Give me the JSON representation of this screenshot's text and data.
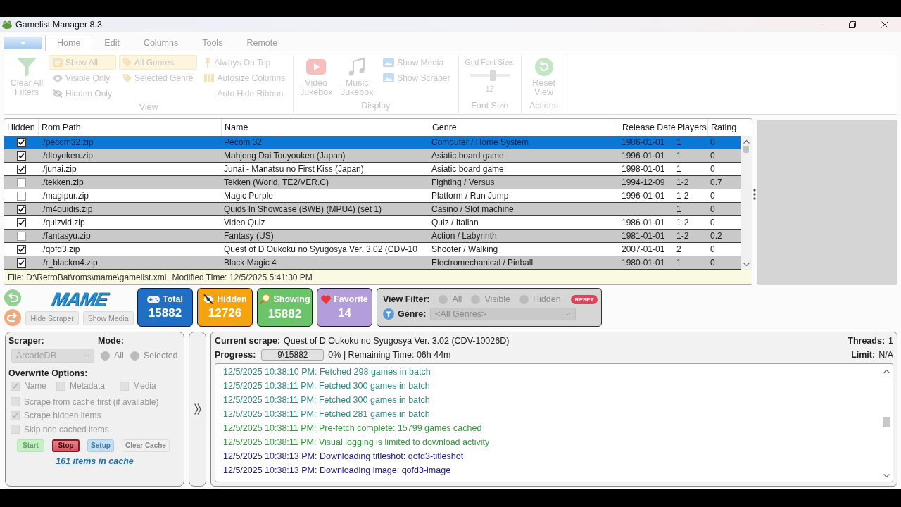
{
  "window": {
    "title": "Gamelist Manager 8.3"
  },
  "ribbon": {
    "disabled": true,
    "tabs": [
      {
        "label": "Home",
        "selected": true
      },
      {
        "label": "Edit",
        "selected": false
      },
      {
        "label": "Columns",
        "selected": false
      },
      {
        "label": "Tools",
        "selected": false
      },
      {
        "label": "Remote",
        "selected": false
      }
    ],
    "groups": [
      {
        "label": "View",
        "columns": [
          [
            {
              "kind": "large",
              "label": "Clear All Filters"
            }
          ],
          [
            {
              "kind": "toggle",
              "label": "Show All",
              "selected": true
            },
            {
              "kind": "toggle",
              "label": "Visible Only",
              "selected": false
            },
            {
              "kind": "toggle",
              "label": "Hidden Only",
              "selected": false
            }
          ],
          [
            {
              "kind": "toggle",
              "label": "All Genres",
              "selected": true
            },
            {
              "kind": "toggle",
              "label": "Selected Genre",
              "selected": false
            }
          ],
          [
            {
              "kind": "small",
              "label": "Always On Top"
            },
            {
              "kind": "small",
              "label": "Autosize Columns"
            },
            {
              "kind": "small",
              "label": "Auto Hide Ribbon"
            }
          ]
        ]
      },
      {
        "label": "Display",
        "columns": [
          [
            {
              "kind": "large",
              "label": "Video Jukebox"
            }
          ],
          [
            {
              "kind": "large",
              "label": "Music Jukebox"
            }
          ],
          [
            {
              "kind": "small",
              "label": "Show Media"
            },
            {
              "kind": "small",
              "label": "Show Scraper"
            }
          ]
        ]
      },
      {
        "label": "Font Size",
        "columns": [
          [
            {
              "kind": "slider",
              "label": "Grid Font Size:",
              "level": 0.6,
              "value": "12"
            }
          ]
        ]
      },
      {
        "label": "Actions",
        "columns": [
          [
            {
              "kind": "large",
              "label": "Reset View"
            }
          ]
        ]
      }
    ]
  },
  "table": {
    "columns": [
      "Hidden",
      "Rom Path",
      "Name",
      "Genre",
      "Release Date",
      "Players",
      "Rating"
    ],
    "rows": [
      {
        "selected": true,
        "hidden": true,
        "rom_path": "./pecom32.zip",
        "name": "Pecom 32",
        "genre": "Computer / Home System",
        "release_date": "1986-01-01",
        "players": "1",
        "rating": "0"
      },
      {
        "selected": false,
        "hidden": true,
        "rom_path": "./dtoyoken.zip",
        "name": "Mahjong Dai Touyouken (Japan)",
        "genre": "Asiatic board game",
        "release_date": "1996-01-01",
        "players": "1",
        "rating": "0"
      },
      {
        "selected": false,
        "hidden": true,
        "rom_path": "./junai.zip",
        "name": "Junai - Manatsu no First Kiss (Japan)",
        "genre": "Asiatic board game",
        "release_date": "1998-01-01",
        "players": "1",
        "rating": "0"
      },
      {
        "selected": false,
        "hidden": false,
        "rom_path": "./tekken.zip",
        "name": "Tekken (World, TE2/VER.C)",
        "genre": "Fighting / Versus",
        "release_date": "1994-12-09",
        "players": "1-2",
        "rating": "0.7"
      },
      {
        "selected": false,
        "hidden": false,
        "rom_path": "./magipur.zip",
        "name": "Magic Purple",
        "genre": "Platform / Run Jump",
        "release_date": "1996-01-01",
        "players": "1-2",
        "rating": "0"
      },
      {
        "selected": false,
        "hidden": true,
        "rom_path": "./m4quidis.zip",
        "name": "Quids In Showcase (BWB) (MPU4) (set 1)",
        "genre": "Casino / Slot machine",
        "players": "1",
        "rating": "0"
      },
      {
        "selected": false,
        "hidden": true,
        "rom_path": "./quizvid.zip",
        "name": "Video Quiz",
        "genre": "Quiz / Italian",
        "release_date": "1986-01-01",
        "players": "1-2",
        "rating": "0"
      },
      {
        "selected": false,
        "hidden": false,
        "rom_path": "./fantasyu.zip",
        "name": "Fantasy (US)",
        "genre": "Action / Labyrinth",
        "release_date": "1981-01-01",
        "players": "1-2",
        "rating": "0.2"
      },
      {
        "selected": false,
        "hidden": true,
        "rom_path": "./qofd3.zip",
        "name": "Quest of D Oukoku no Syugosya Ver. 3.02 (CDV-10",
        "genre": "Shooter / Walking",
        "release_date": "2007-01-01",
        "players": "2",
        "rating": "0"
      },
      {
        "selected": false,
        "hidden": true,
        "rom_path": "./r_blackm4.zip",
        "name": "Black Magic 4",
        "genre": "Electromechanical / Pinball",
        "release_date": "1980-01-01",
        "players": "1",
        "rating": "0"
      }
    ],
    "status": {
      "file": "File: D:\\RetroBat\\roms\\mame\\gamelist.xml",
      "modified": "Modified Time: 12/5/2025 5:41:30 PM"
    }
  },
  "toolbar": {
    "logo": "MAME",
    "buttons": [
      "Hide Scraper",
      "Show Media"
    ]
  },
  "stats": [
    {
      "label": "Total",
      "value": "15882",
      "color": "#1f6fc5"
    },
    {
      "label": "Hidden",
      "value": "12726",
      "color": "#f5a30f"
    },
    {
      "label": "Showing",
      "value": "15882",
      "color": "#6cc46a"
    },
    {
      "label": "Favorite",
      "value": "14",
      "color": "#b39ddb"
    }
  ],
  "view_filter": {
    "label": "View Filter:",
    "disabled": true,
    "options": [
      {
        "label": "All",
        "selected": false
      },
      {
        "label": "Visible",
        "selected": false
      },
      {
        "label": "Hidden",
        "selected": false
      }
    ],
    "reset": "RESET",
    "genre_label": "Genre:",
    "genre": "<All Genres>"
  },
  "scraper": {
    "label": "Scraper:",
    "disabled": true,
    "source": "ArcadeDB",
    "mode_label": "Mode:",
    "modes": [
      {
        "label": "All",
        "selected": false
      },
      {
        "label": "Selected",
        "selected": false
      }
    ],
    "overwrite_label": "Overwrite Options:",
    "overwrite": [
      {
        "label": "Name",
        "checked": true
      },
      {
        "label": "Metadata",
        "checked": false
      },
      {
        "label": "Media",
        "checked": false
      }
    ],
    "options": [
      {
        "label": "Scrape from cache first (if available)",
        "checked": false
      },
      {
        "label": "Scrape hidden items",
        "checked": true
      },
      {
        "label": "Skip non cached items",
        "checked": false
      }
    ],
    "buttons": [
      {
        "kind": "start",
        "label": "Start",
        "disabled": true
      },
      {
        "kind": "stop",
        "label": "Stop",
        "disabled": false
      },
      {
        "kind": "setup",
        "label": "Setup",
        "disabled": true
      },
      {
        "kind": "clear",
        "label": "Clear Cache",
        "disabled": true
      }
    ],
    "cache_note": "161 items in cache"
  },
  "scrape_status": {
    "current_label": "Current scrape:",
    "current": "Quest of D Oukoku no Syugosya Ver. 3.02 (CDV-10026D)",
    "threads_label": "Threads:",
    "threads": "1",
    "progress_label": "Progress:",
    "progress": {
      "text": "9\\15882",
      "level": 0.0006
    },
    "progress_info": "0% | Remaining Time: 06h 44m",
    "limit_label": "Limit:",
    "limit": "N/A",
    "log": [
      {
        "text": "12/5/2025 10:38:10 PM: Fetched 298 games in batch",
        "color": "#2a8a82"
      },
      {
        "text": "12/5/2025 10:38:11 PM: Fetched 300 games in batch",
        "color": "#2a8a82"
      },
      {
        "text": "12/5/2025 10:38:11 PM: Fetched 300 games in batch",
        "color": "#2a8a82"
      },
      {
        "text": "12/5/2025 10:38:11 PM: Fetched 281 games in batch",
        "color": "#2a8a82"
      },
      {
        "text": "12/5/2025 10:38:11 PM: Pre-fetch complete: 15799 games cached",
        "color": "#2f9a3a"
      },
      {
        "text": "12/5/2025 10:38:11 PM: Visual logging is limited to download activity",
        "color": "#2f9a3a"
      },
      {
        "text": "12/5/2025 10:38:13 PM: Downloading titleshot: qofd3-titleshot",
        "color": "#1a1a8e"
      },
      {
        "text": "12/5/2025 10:38:13 PM: Downloading image: qofd3-image",
        "color": "#1a1a8e"
      }
    ]
  }
}
